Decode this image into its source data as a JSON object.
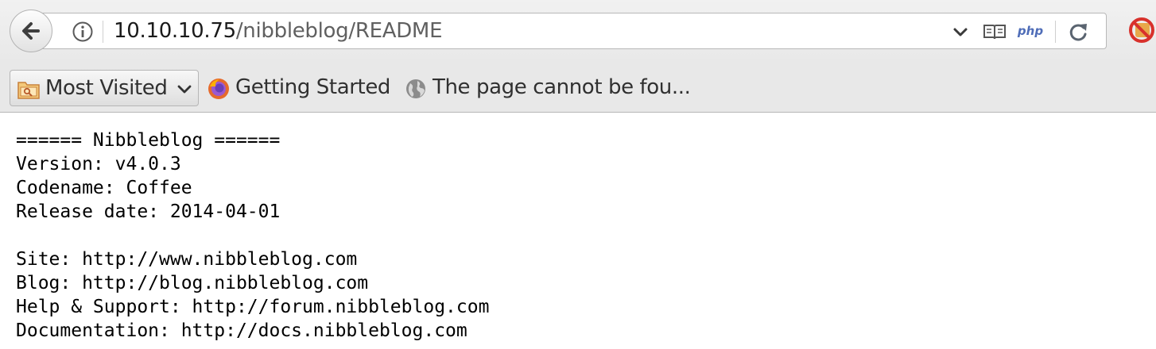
{
  "nav": {
    "url_host": "10.10.10.75",
    "url_path": "/nibbleblog/README",
    "php_badge": "php"
  },
  "bookmarks": {
    "most_visited": "Most Visited",
    "getting_started": "Getting Started",
    "page_cannot": "The page cannot be fou..."
  },
  "icons": {
    "back": "back-arrow-icon",
    "info": "info-icon",
    "dropdown": "chevron-down-icon",
    "reader": "reader-view-icon",
    "reload": "reload-icon",
    "blocked": "blocked-icon",
    "folder": "bookmark-folder-icon",
    "firefox": "firefox-icon",
    "globe": "globe-icon"
  },
  "content": {
    "lines": [
      "====== Nibbleblog ======",
      "Version: v4.0.3",
      "Codename: Coffee",
      "Release date: 2014-04-01",
      "",
      "Site: http://www.nibbleblog.com",
      "Blog: http://blog.nibbleblog.com",
      "Help & Support: http://forum.nibbleblog.com",
      "Documentation: http://docs.nibbleblog.com"
    ]
  },
  "colors": {
    "toolbar_bg": "#e8e8e8",
    "page_bg": "#ffffff",
    "url_path_text": "#606060",
    "php_badge": "#4f6db8"
  }
}
